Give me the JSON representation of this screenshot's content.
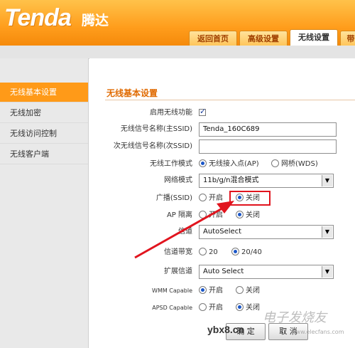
{
  "header": {
    "logo": "Tenda",
    "logo_cn": "腾达",
    "tabs": [
      {
        "label": "返回首页"
      },
      {
        "label": "高级设置"
      },
      {
        "label": "无线设置"
      },
      {
        "label": "带"
      }
    ],
    "active_tab": "无线设置",
    "brand_color": "#ff9d1c"
  },
  "sidebar": {
    "items": [
      {
        "label": "无线基本设置",
        "active": true
      },
      {
        "label": "无线加密",
        "active": false
      },
      {
        "label": "无线访问控制",
        "active": false
      },
      {
        "label": "无线客户端",
        "active": false
      }
    ]
  },
  "main": {
    "section_title": "无线基本设置",
    "enable_wireless": {
      "label": "启用无线功能",
      "checked": true
    },
    "ssid_primary": {
      "label": "无线信号名称(主SSID)",
      "value": "Tenda_160C689"
    },
    "ssid_secondary": {
      "label": "次无线信号名称(次SSID)",
      "value": ""
    },
    "work_mode": {
      "label": "无线工作模式",
      "options": [
        "无线接入点(AP)",
        "网桥(WDS)"
      ],
      "selected": "无线接入点(AP)"
    },
    "network_mode": {
      "label": "网络模式",
      "value": "11b/g/n混合模式"
    },
    "broadcast": {
      "label": "广播(SSID)",
      "options": [
        "开启",
        "关闭"
      ],
      "selected": "关闭"
    },
    "ap_isolation": {
      "label": "AP 隔离",
      "options": [
        "开启",
        "关闭"
      ],
      "selected": "关闭"
    },
    "channel": {
      "label": "信道",
      "value": "AutoSelect"
    },
    "bandwidth": {
      "label": "信道带宽",
      "options": [
        "20",
        "20/40"
      ],
      "selected": "20/40"
    },
    "ext_channel": {
      "label": "扩展信道",
      "value": "Auto Select"
    },
    "wmm": {
      "label": "WMM Capable",
      "options": [
        "开启",
        "关闭"
      ],
      "selected": "开启"
    },
    "apsd": {
      "label": "APSD Capable",
      "options": [
        "开启",
        "关闭"
      ],
      "selected": "关闭"
    },
    "buttons": {
      "ok": "确 定",
      "cancel": "取 消"
    }
  },
  "watermark": {
    "site": "ybx8.cn",
    "brand": "电子发烧友",
    "url": "www.elecfans.com"
  },
  "colors": {
    "accent": "#ff9a18",
    "title": "#e06a00",
    "highlight": "#e1141e"
  }
}
